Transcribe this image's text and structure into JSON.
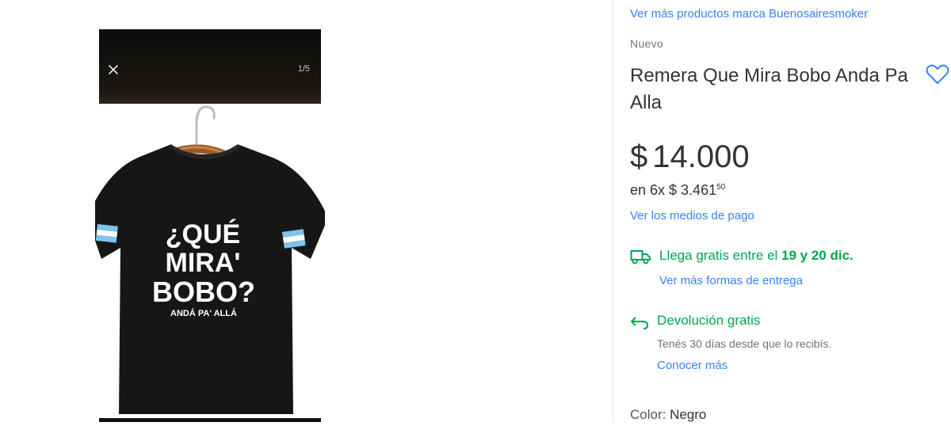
{
  "gallery": {
    "counter": "1/5",
    "shirt_text": {
      "line1": "¿QUÉ",
      "line2": "MIRA'",
      "line3": "BOBO?",
      "line4": "ANDÁ PA' ALLÁ"
    }
  },
  "product": {
    "brand_link": "Ver más productos marca Buenosairesmoker",
    "condition": "Nuevo",
    "title": "Remera Que Mira Bobo Anda Pa Alla",
    "price": {
      "currency": "$",
      "amount": "14.000",
      "installments_prefix": "en 6x $ 3.461",
      "installments_cents": "50"
    },
    "payment_link": "Ver los medios de pago",
    "shipping": {
      "text_main": "Llega gratis entre el ",
      "text_bold": "19 y 20 dic.",
      "link": "Ver más formas de entrega"
    },
    "returns": {
      "title": "Devolución gratis",
      "subtitle": "Tenés 30 días desde que lo recibís.",
      "link": "Conocer más"
    },
    "color": {
      "label": "Color: ",
      "value": "Negro"
    }
  },
  "colors": {
    "link": "#3483fa",
    "success": "#00a650",
    "text": "#333333",
    "muted": "#737373"
  },
  "icons": [
    "close-icon",
    "heart-icon",
    "truck-icon",
    "return-icon"
  ]
}
